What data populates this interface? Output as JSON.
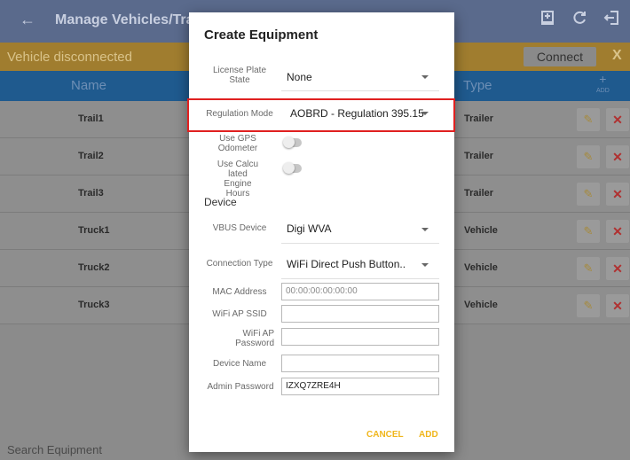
{
  "app": {
    "back_icon": "←",
    "title": "Manage Vehicles/Trailers",
    "icons": [
      "export-icon",
      "refresh-icon",
      "logout-icon"
    ]
  },
  "status": {
    "message": "Vehicle disconnected",
    "connect_label": "Connect",
    "close_label": "X"
  },
  "table": {
    "headers": {
      "name": "Name",
      "type": "Type",
      "add_icon": "+",
      "add_label": "ADD"
    },
    "rows": [
      {
        "name": "Trail1",
        "type": "Trailer"
      },
      {
        "name": "Trail2",
        "type": "Trailer"
      },
      {
        "name": "Trail3",
        "type": "Trailer"
      },
      {
        "name": "Truck1",
        "type": "Vehicle"
      },
      {
        "name": "Truck2",
        "type": "Vehicle"
      },
      {
        "name": "Truck3",
        "type": "Vehicle"
      }
    ]
  },
  "search": {
    "placeholder": "Search Equipment"
  },
  "dialog": {
    "title": "Create Equipment",
    "license_plate_state": {
      "label": "License Plate State",
      "value": "None"
    },
    "regulation_mode": {
      "label": "Regulation Mode",
      "value": "AOBRD - Regulation 395.15"
    },
    "use_gps_odometer": {
      "label": "Use GPS Odometer",
      "on": false
    },
    "use_calculated_engine_hours": {
      "label": "Use Calcu lated Engine Hours",
      "on": false
    },
    "device_section": "Device",
    "vbus_device": {
      "label": "VBUS Device",
      "value": "Digi WVA"
    },
    "connection_type": {
      "label": "Connection Type",
      "value": "WiFi Direct Push Button.."
    },
    "mac_address": {
      "label": "MAC Address",
      "placeholder": "00:00:00:00:00:00",
      "value": ""
    },
    "wifi_ap_ssid": {
      "label": "WiFi AP SSID",
      "value": ""
    },
    "wifi_ap_password": {
      "label": "WiFi AP Password",
      "value": ""
    },
    "device_name": {
      "label": "Device Name",
      "value": ""
    },
    "admin_password": {
      "label": "Admin Password",
      "value": "IZXQ7ZRE4H"
    },
    "cancel_label": "CANCEL",
    "add_label": "ADD"
  },
  "colors": {
    "accent": "#f0b61c",
    "highlight": "#e02020",
    "topbar": "#5a6a8c",
    "statusbar": "#a07d2f",
    "header_row": "#1f5a8e"
  }
}
